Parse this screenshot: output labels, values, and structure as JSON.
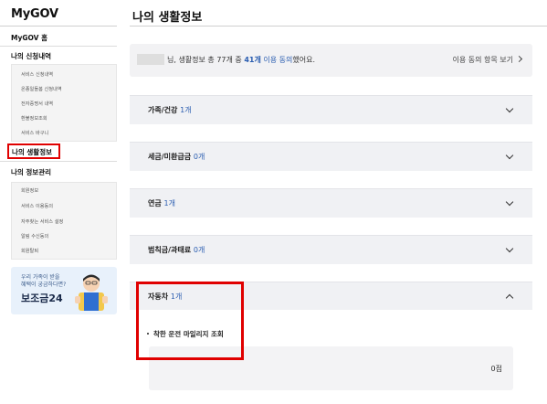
{
  "sidebar": {
    "brand": "MyGOV",
    "home": "MyGOV 홈",
    "section1": "나의 신청내역",
    "section1_items": [
      "서비스 신청내역",
      "온종일돌봄 신청내역",
      "전자증명서 내역",
      "환불정보조회",
      "서비스 바구니"
    ],
    "section2_active": "나의 생활정보",
    "section3": "나의 정보관리",
    "section3_items": [
      "회원정보",
      "서비스 이용동의",
      "자주찾는 서비스 설정",
      "알림 수신동의",
      "회원탈퇴"
    ],
    "banner": {
      "line1": "우리 가족이 받을",
      "line2": "혜택이 궁금하다면?",
      "title": "보조금24"
    }
  },
  "main": {
    "title": "나의 생활정보",
    "summary": {
      "prefix": "님, 생활정보 총 77개 중 ",
      "highlight": "41개",
      "consent": " 이용 동의",
      "suffix": "했어요.",
      "link": "이용 동의 항목 보기"
    },
    "accordions": [
      {
        "label": "가족/건강",
        "count": "1개",
        "open": false
      },
      {
        "label": "세금/미환급금",
        "count": "0개",
        "open": false
      },
      {
        "label": "연금",
        "count": "1개",
        "open": false
      },
      {
        "label": "범칙금/과태료",
        "count": "0개",
        "open": false
      },
      {
        "label": "자동차",
        "count": "1개",
        "open": true
      }
    ],
    "open_item": {
      "label": "착한 운전 마일리지 조회",
      "value": "0점"
    }
  },
  "colors": {
    "accent": "#2a5db0",
    "highlight_box": "#e00000",
    "accordion_bg": "#f0f1f4"
  }
}
